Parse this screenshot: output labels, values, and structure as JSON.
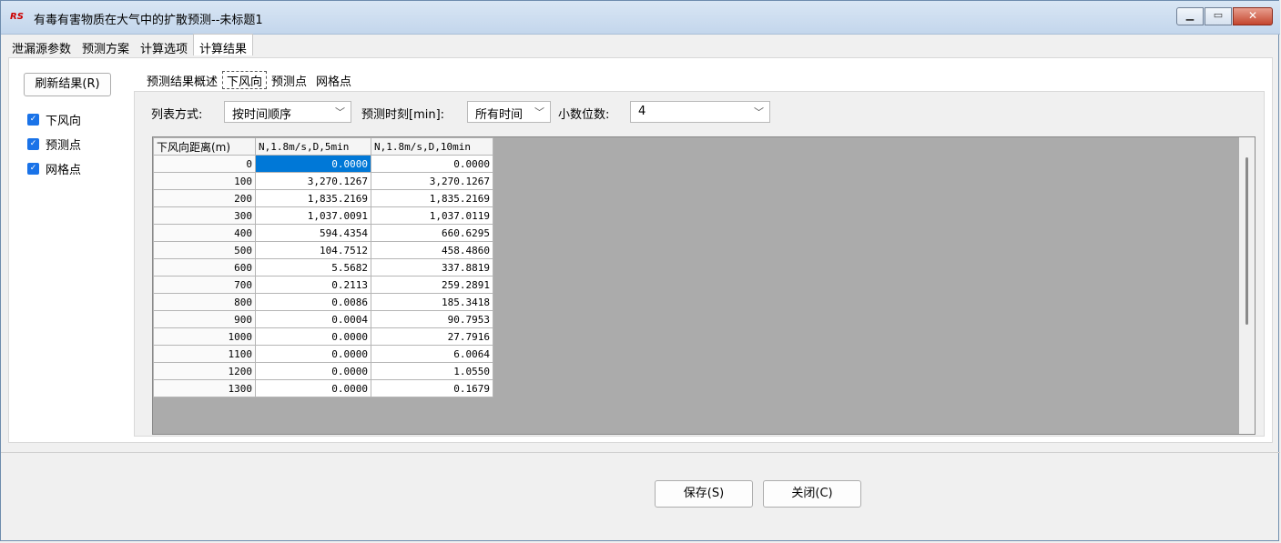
{
  "window": {
    "app_icon": "RS",
    "title": "有毒有害物质在大气中的扩散预测--未标题1",
    "controls": [
      "minimize-icon",
      "maximize-icon",
      "close-icon"
    ]
  },
  "main_tabs": [
    "泄漏源参数",
    "预测方案",
    "计算选项",
    "计算结果"
  ],
  "main_tab_active": "计算结果",
  "left": {
    "refresh_label": "刷新结果(R)",
    "checkboxes": [
      {
        "label": "下风向",
        "checked": true
      },
      {
        "label": "预测点",
        "checked": true
      },
      {
        "label": "网格点",
        "checked": true
      }
    ]
  },
  "sub_tabs": [
    "预测结果概述",
    "下风向",
    "预测点",
    "网格点"
  ],
  "sub_tab_active": "下风向",
  "controls": {
    "list_mode_label": "列表方式:",
    "list_mode_value": "按时间顺序",
    "time_label": "预测时刻[min]:",
    "time_value": "所有时间",
    "decimals_label": "小数位数:",
    "decimals_value": "4"
  },
  "table": {
    "headers": [
      "下风向距离(m)",
      "N,1.8m/s,D,5min",
      "N,1.8m/s,D,10min"
    ],
    "rows": [
      [
        "0",
        "0.0000",
        "0.0000"
      ],
      [
        "100",
        "3,270.1267",
        "3,270.1267"
      ],
      [
        "200",
        "1,835.2169",
        "1,835.2169"
      ],
      [
        "300",
        "1,037.0091",
        "1,037.0119"
      ],
      [
        "400",
        "594.4354",
        "660.6295"
      ],
      [
        "500",
        "104.7512",
        "458.4860"
      ],
      [
        "600",
        "5.5682",
        "337.8819"
      ],
      [
        "700",
        "0.2113",
        "259.2891"
      ],
      [
        "800",
        "0.0086",
        "185.3418"
      ],
      [
        "900",
        "0.0004",
        "90.7953"
      ],
      [
        "1000",
        "0.0000",
        "27.7916"
      ],
      [
        "1100",
        "0.0000",
        "6.0064"
      ],
      [
        "1200",
        "0.0000",
        "1.0550"
      ],
      [
        "1300",
        "0.0000",
        "0.1679"
      ]
    ],
    "selected_cell": {
      "row": 0,
      "col": 1
    }
  },
  "footer": {
    "save_label": "保存(S)",
    "close_label": "关闭(C)"
  },
  "colors": {
    "selection": "#0078d7",
    "checkbox": "#1a73e8",
    "empty_grid": "#ababab"
  }
}
